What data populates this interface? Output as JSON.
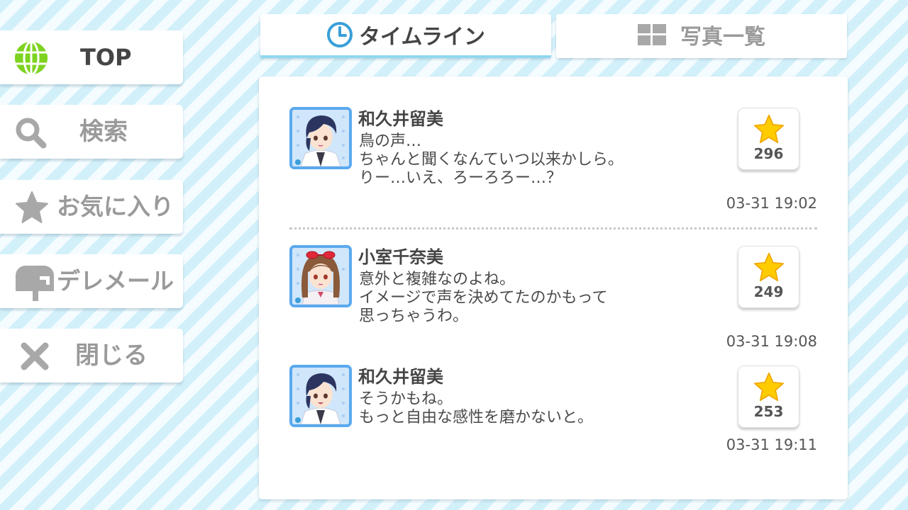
{
  "sidebar": {
    "top": "TOP",
    "search": "検索",
    "favorites": "お気に入り",
    "mail": "デレメール",
    "close": "閉じる"
  },
  "tabs": {
    "timeline": "タイムライン",
    "photos": "写真一覧"
  },
  "posts": [
    {
      "author": "和久井留美",
      "lines": [
        "鳥の声…",
        "ちゃんと聞くなんていつ以来かしら。",
        "りー…いえ、ろーろろー…？"
      ],
      "likes": "296",
      "time": "03-31 19:02"
    },
    {
      "author": "小室千奈美",
      "lines": [
        "意外と複雑なのよね。",
        "イメージで声を決めてたのかもって",
        "思っちゃうわ。"
      ],
      "likes": "249",
      "time": "03-31 19:08"
    },
    {
      "author": "和久井留美",
      "lines": [
        "そうかもね。",
        "もっと自由な感性を磨かないと。"
      ],
      "likes": "253",
      "time": "03-31 19:11"
    }
  ],
  "icons": {
    "top": "globe-icon",
    "search": "search-icon",
    "favorites": "star-icon",
    "mail": "mailbox-icon",
    "close": "close-icon",
    "timeline": "clock-icon",
    "photos": "grid-icon",
    "like": "star-icon"
  },
  "colors": {
    "accent_blue": "#5aa9ee",
    "globe_green": "#7ed321",
    "star_yellow": "#ffcc00",
    "inactive_gray": "#9a9a9a"
  }
}
